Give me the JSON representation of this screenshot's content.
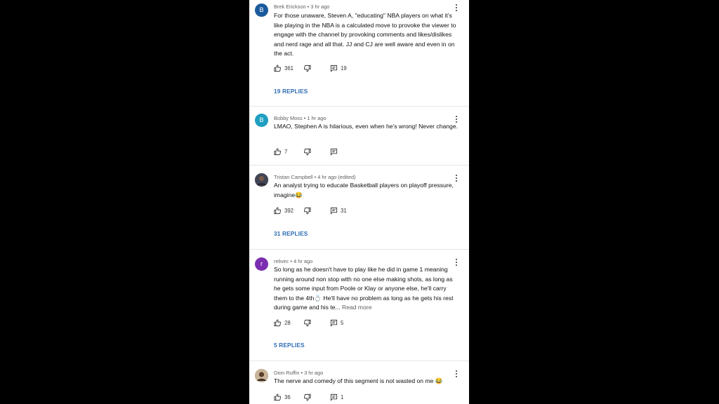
{
  "colors": {
    "link": "#2f6db5",
    "avatar_brek": "#1a5a9c",
    "avatar_bobby": "#1f9fc0",
    "avatar_relivec": "#7b2fb0"
  },
  "comments": [
    {
      "author": "Brek Erickson",
      "time": "3 hr ago",
      "avatar_letter": "B",
      "text": "For those unaware, Steven A, \"educating\" NBA players on what it's like playing in the NBA is a calculated move to provoke the viewer to engage with the channel by provoking comments and likes/dislikes and nerd rage and all that. JJ and CJ are well aware and even in on the act.",
      "likes": "361",
      "reply_count": "19",
      "replies_link": "19 REPLIES"
    },
    {
      "author": "Bobby Moss",
      "time": "1 hr ago",
      "avatar_letter": "B",
      "text": "LMAO, Stephen A is hilarious, even when he's wrong! Never change.",
      "likes": "7",
      "reply_count": "",
      "replies_link": ""
    },
    {
      "author": "Tristan Campbell",
      "time": "4 hr ago (edited)",
      "avatar_letter": "",
      "text": "An analyst trying to educate Basketball players on playoff pressure, imagine😂",
      "likes": "392",
      "reply_count": "31",
      "replies_link": "31 REPLIES"
    },
    {
      "author": "relivec",
      "time": "4 hr ago",
      "avatar_letter": "r",
      "text": "So long as he doesn't have to play like he did in game 1 meaning running around non stop with no one else making shots, as long as he gets some input from Poole or Klay or anyone else, he'll carry them to the 4th💍 He'll have no problem as long as he gets his rest during game and his te...",
      "read_more": "Read more",
      "likes": "28",
      "reply_count": "5",
      "replies_link": "5 REPLIES"
    },
    {
      "author": "Dion Ruffin",
      "time": "3 hr ago",
      "avatar_letter": "",
      "text": "The nerve and comedy of this segment is not wasted on me 😂",
      "likes": "36",
      "reply_count": "1",
      "replies_link": ""
    }
  ]
}
